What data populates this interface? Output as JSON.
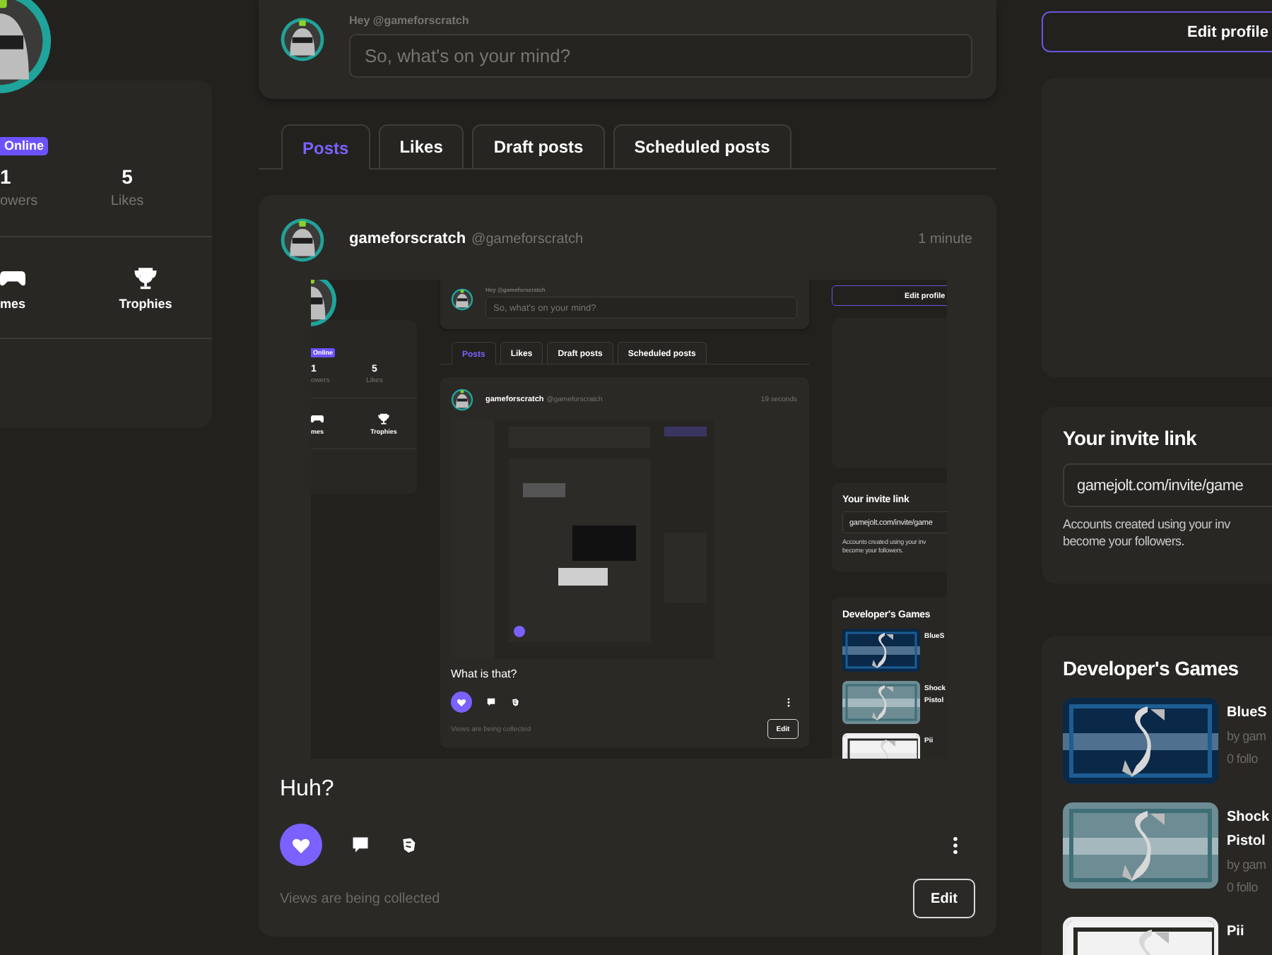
{
  "profile": {
    "status": "Online",
    "stats": [
      {
        "value": "1",
        "label": "owers"
      },
      {
        "value": "5",
        "label": "Likes"
      }
    ],
    "links": [
      {
        "kind": "gamepad",
        "label": "mes"
      },
      {
        "kind": "trophy",
        "label": "Trophies"
      }
    ]
  },
  "composer": {
    "greeting": "Hey @gameforscratch",
    "placeholder": "So, what's on your mind?"
  },
  "tabs": [
    {
      "label": "Posts",
      "selected": true
    },
    {
      "label": "Likes",
      "selected": false
    },
    {
      "label": "Draft posts",
      "selected": false
    },
    {
      "label": "Scheduled posts",
      "selected": false
    }
  ],
  "post": {
    "author": "gameforscratch",
    "handle": "@gameforscratch",
    "time": "1 minute",
    "text": "Huh?",
    "liked": true,
    "views": "Views are being collected",
    "edit": "Edit",
    "media": {
      "kind": "screenshot",
      "page": {
        "profile": {
          "status": "Online",
          "stats": [
            {
              "value": "1",
              "label": "owers"
            },
            {
              "value": "5",
              "label": "Likes"
            }
          ],
          "links": [
            {
              "kind": "gamepad",
              "label": "mes"
            },
            {
              "kind": "trophy",
              "label": "Trophies"
            }
          ]
        },
        "composer": {
          "greeting": "Hey @gameforscratch",
          "placeholder": "So, what's on your mind?"
        },
        "tabs": [
          {
            "label": "Posts",
            "selected": true
          },
          {
            "label": "Likes",
            "selected": false
          },
          {
            "label": "Draft posts",
            "selected": false
          },
          {
            "label": "Scheduled posts",
            "selected": false
          }
        ],
        "post": {
          "author": "gameforscratch",
          "handle": "@gameforscratch",
          "time": "19 seconds",
          "text": "What is that?",
          "liked": true,
          "views": "Views are being collected",
          "edit": "Edit"
        },
        "sidebar": {
          "edit_profile": "Edit profile",
          "invite": {
            "title": "Your invite link",
            "link": "gamejolt.com/invite/game",
            "note": "Accounts created using your inv\nbecome your followers."
          },
          "games": {
            "title": "Developer's Games",
            "items": [
              {
                "title": "BlueS"
              },
              {
                "title": "Shock Pistol"
              },
              {
                "title": "Pii"
              }
            ]
          }
        }
      }
    }
  },
  "sidebar": {
    "edit_profile": "Edit profile",
    "invite": {
      "title": "Your invite link",
      "link": "gamejolt.com/invite/game",
      "note": "Accounts created using your inv\nbecome your followers."
    },
    "games": {
      "title": "Developer's Games",
      "items": [
        {
          "title": "BlueS",
          "by": "by gam",
          "followers": "0 follo"
        },
        {
          "title": "Shock Pistol",
          "by": "by gam",
          "followers": "0 follo"
        },
        {
          "title": "Pii"
        }
      ]
    }
  }
}
